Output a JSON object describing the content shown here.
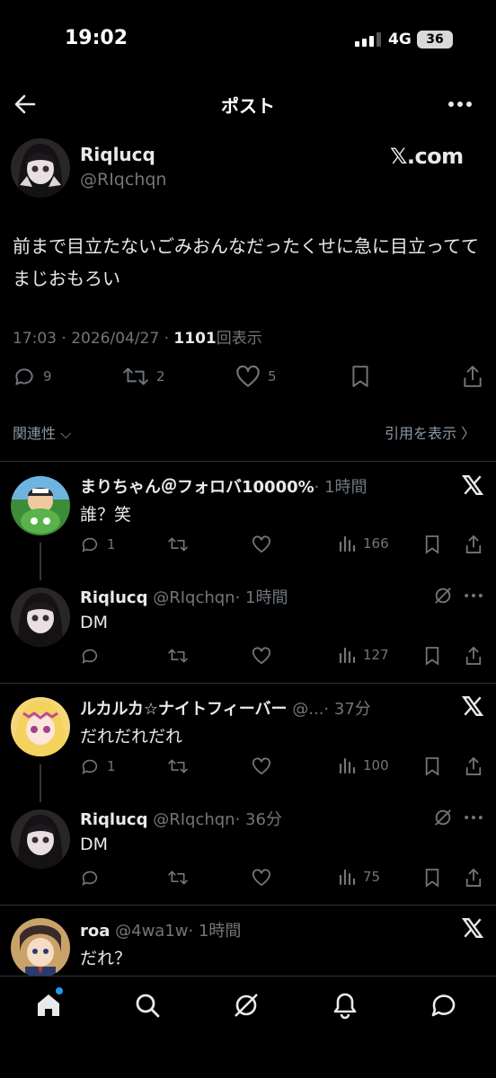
{
  "status": {
    "time": "19:02",
    "network": "4G",
    "battery": "36"
  },
  "header": {
    "title": "ポスト"
  },
  "post": {
    "author_name": "Riqlucq",
    "author_handle": "@RIqchqn",
    "source_badge": "𝕏.com",
    "text": "前まで目立たないごみおんなだったくせに急に目立っててまじおもろい",
    "time": "17:03 · 2026/04/27 · ",
    "views_count": "1101",
    "views_label": "回表示",
    "replies": "9",
    "reposts": "2",
    "likes": "5"
  },
  "filters": {
    "sort": "関連性",
    "quotes": "引用を表示"
  },
  "replies": [
    {
      "name": "まりちゃん＠フォロバ10000%",
      "handle": "",
      "time": "· 1時間",
      "text": "誰？笑",
      "replies": "1",
      "views": "166"
    },
    {
      "name": "Riqlucq",
      "handle": "@RIqchqn",
      "time": "· 1時間",
      "text": "DM",
      "replies": "",
      "views": "127"
    },
    {
      "name": "ルカルカ☆ナイトフィーバー",
      "handle": "@...",
      "time": "· 37分",
      "text": "だれだれだれ",
      "replies": "1",
      "views": "100"
    },
    {
      "name": "Riqlucq",
      "handle": "@RIqchqn",
      "time": "· 36分",
      "text": "DM",
      "replies": "",
      "views": "75"
    },
    {
      "name": "roa",
      "handle": "@4wa1w",
      "time": "· 1時間",
      "text": "だれ？",
      "replies": "",
      "views": ""
    }
  ],
  "icons": {
    "back": "arrow-left-icon",
    "more": "more-icon",
    "reply": "reply-icon",
    "repost": "repost-icon",
    "like": "heart-icon",
    "bookmark": "bookmark-icon",
    "share": "share-icon",
    "views": "views-icon",
    "grok": "grok-icon",
    "x": "x-logo-icon",
    "home": "home-icon",
    "search": "search-icon",
    "notifications": "bell-icon",
    "messages": "message-icon"
  },
  "colors": {
    "background": "#000000",
    "text": "#e7e9ea",
    "muted": "#71767b",
    "accent": "#1d9bf0"
  }
}
